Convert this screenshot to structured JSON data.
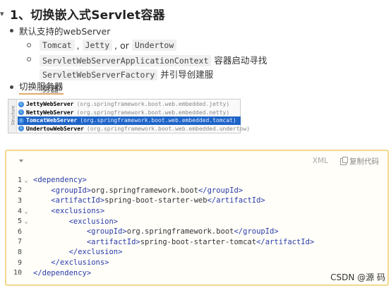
{
  "heading": {
    "caret": "▾",
    "title": "1、切换嵌入式Servlet容器"
  },
  "bullets": {
    "default_support": "默认支持的webServer",
    "servers": [
      "Tomcat",
      "Jetty",
      "Undertow"
    ],
    "or_word": ", or",
    "comma": ",",
    "factory_code": "ServletWebServerApplicationContext",
    "factory_text_1": " 容器启动寻找",
    "factory_code_2": "ServletWebServerFactory",
    "factory_text_2": " 并引导创建服",
    "factory_text_3": "务器",
    "switch_server": "切换服务器"
  },
  "popup": {
    "side_label": "Structure",
    "items": [
      {
        "name": "JettyWebServer",
        "pkg": "(org.springframework.boot.web.embedded.jetty)",
        "selected": false
      },
      {
        "name": "NettyWebServer",
        "pkg": "(org.springframework.boot.web.embedded.netty)",
        "selected": false
      },
      {
        "name": "TomcatWebServer",
        "pkg": "(org.springframework.boot.web.embedded.tomcat)",
        "selected": true
      },
      {
        "name": "UndertowWebServer",
        "pkg": "(org.springframework.boot.web.embedded.undertow)",
        "selected": false
      }
    ]
  },
  "codeblock": {
    "language": "XML",
    "copy_label": "复制代码",
    "lines": [
      {
        "n": "1",
        "fold": "⌄",
        "indent": "",
        "open": "<dependency>",
        "value": "",
        "close": ""
      },
      {
        "n": "2",
        "fold": "",
        "indent": "    ",
        "open": "<groupId>",
        "value": "org.springframework.boot",
        "close": "</groupId>"
      },
      {
        "n": "3",
        "fold": "",
        "indent": "    ",
        "open": "<artifactId>",
        "value": "spring-boot-starter-web",
        "close": "</artifactId>"
      },
      {
        "n": "4",
        "fold": "⌄",
        "indent": "    ",
        "open": "<exclusions>",
        "value": "",
        "close": ""
      },
      {
        "n": "5",
        "fold": "⌄",
        "indent": "        ",
        "open": "<exclusion>",
        "value": "",
        "close": ""
      },
      {
        "n": "6",
        "fold": "",
        "indent": "            ",
        "open": "<groupId>",
        "value": "org.springframework.boot",
        "close": "</groupId>"
      },
      {
        "n": "7",
        "fold": "",
        "indent": "            ",
        "open": "<artifactId>",
        "value": "spring-boot-starter-tomcat",
        "close": "</artifactId>"
      },
      {
        "n": "8",
        "fold": "",
        "indent": "        ",
        "open": "</exclusion>",
        "value": "",
        "close": ""
      },
      {
        "n": "9",
        "fold": "",
        "indent": "    ",
        "open": "</exclusions>",
        "value": "",
        "close": ""
      },
      {
        "n": "10",
        "fold": "",
        "indent": "",
        "open": "</dependency>",
        "value": "",
        "close": ""
      }
    ]
  },
  "watermark": "CSDN @源  码"
}
